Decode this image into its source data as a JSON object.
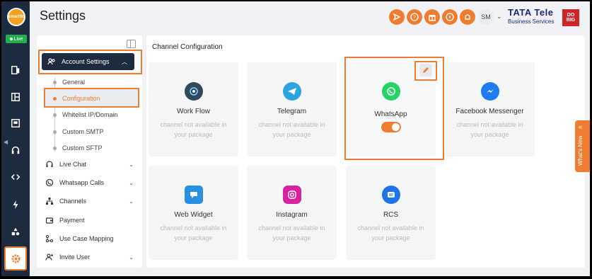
{
  "app": {
    "logo_text": "smartflo",
    "live_label": "Live",
    "page_title": "Settings"
  },
  "topbar": {
    "actions": [
      {
        "name": "send-icon"
      },
      {
        "name": "help-icon"
      },
      {
        "name": "gift-icon"
      },
      {
        "name": "play-icon"
      },
      {
        "name": "bell-icon"
      }
    ],
    "avatar_initials": "SM",
    "brand_name": "TATA Tele",
    "brand_sub": "Business Services",
    "brand_badge": "DO BIG"
  },
  "rail": {
    "items": [
      "contacts-icon",
      "dashboard-icon",
      "monitor-icon",
      "headset-icon",
      "code-icon",
      "bolt-icon",
      "apps-icon",
      "settings-icon"
    ]
  },
  "sidebar": {
    "account_settings": "Account Settings",
    "sub_items": [
      "General",
      "Configuration",
      "Whitelist IP/Domain",
      "Custom SMTP",
      "Custom SFTP"
    ],
    "menu": [
      {
        "label": "Live Chat",
        "icon": "headset-icon",
        "expandable": true
      },
      {
        "label": "Whatsapp Calls",
        "icon": "phone-icon",
        "expandable": true
      },
      {
        "label": "Channels",
        "icon": "hierarchy-icon",
        "expandable": true
      },
      {
        "label": "Payment",
        "icon": "wallet-icon",
        "expandable": false
      },
      {
        "label": "Use Case Mapping",
        "icon": "mapping-icon",
        "expandable": false
      },
      {
        "label": "Invite User",
        "icon": "add-user-icon",
        "expandable": true
      }
    ]
  },
  "main": {
    "title": "Channel Configuration",
    "unavailable_line1": "channel not available in",
    "unavailable_line2": "your package",
    "channels": [
      {
        "name": "Work Flow",
        "icon": "workflow-icon",
        "color": "#2e4a5c"
      },
      {
        "name": "Telegram",
        "icon": "telegram-icon",
        "color": "#2aa3de"
      },
      {
        "name": "WhatsApp",
        "icon": "whatsapp-icon",
        "color": "#25d366",
        "enabled": true
      },
      {
        "name": "Facebook Messenger",
        "icon": "messenger-icon",
        "color": "#1e7cf2"
      },
      {
        "name": "Web Widget",
        "icon": "chat-widget-icon",
        "color": "#2a8fe0"
      },
      {
        "name": "Instagram",
        "icon": "instagram-icon",
        "color": "#d6249f"
      },
      {
        "name": "RCS",
        "icon": "rcs-icon",
        "color": "#1e73e8"
      }
    ]
  },
  "whats_new": "What's New",
  "colors": {
    "accent": "#f07c30",
    "rail": "#1c2b3f",
    "live": "#23b04a"
  }
}
